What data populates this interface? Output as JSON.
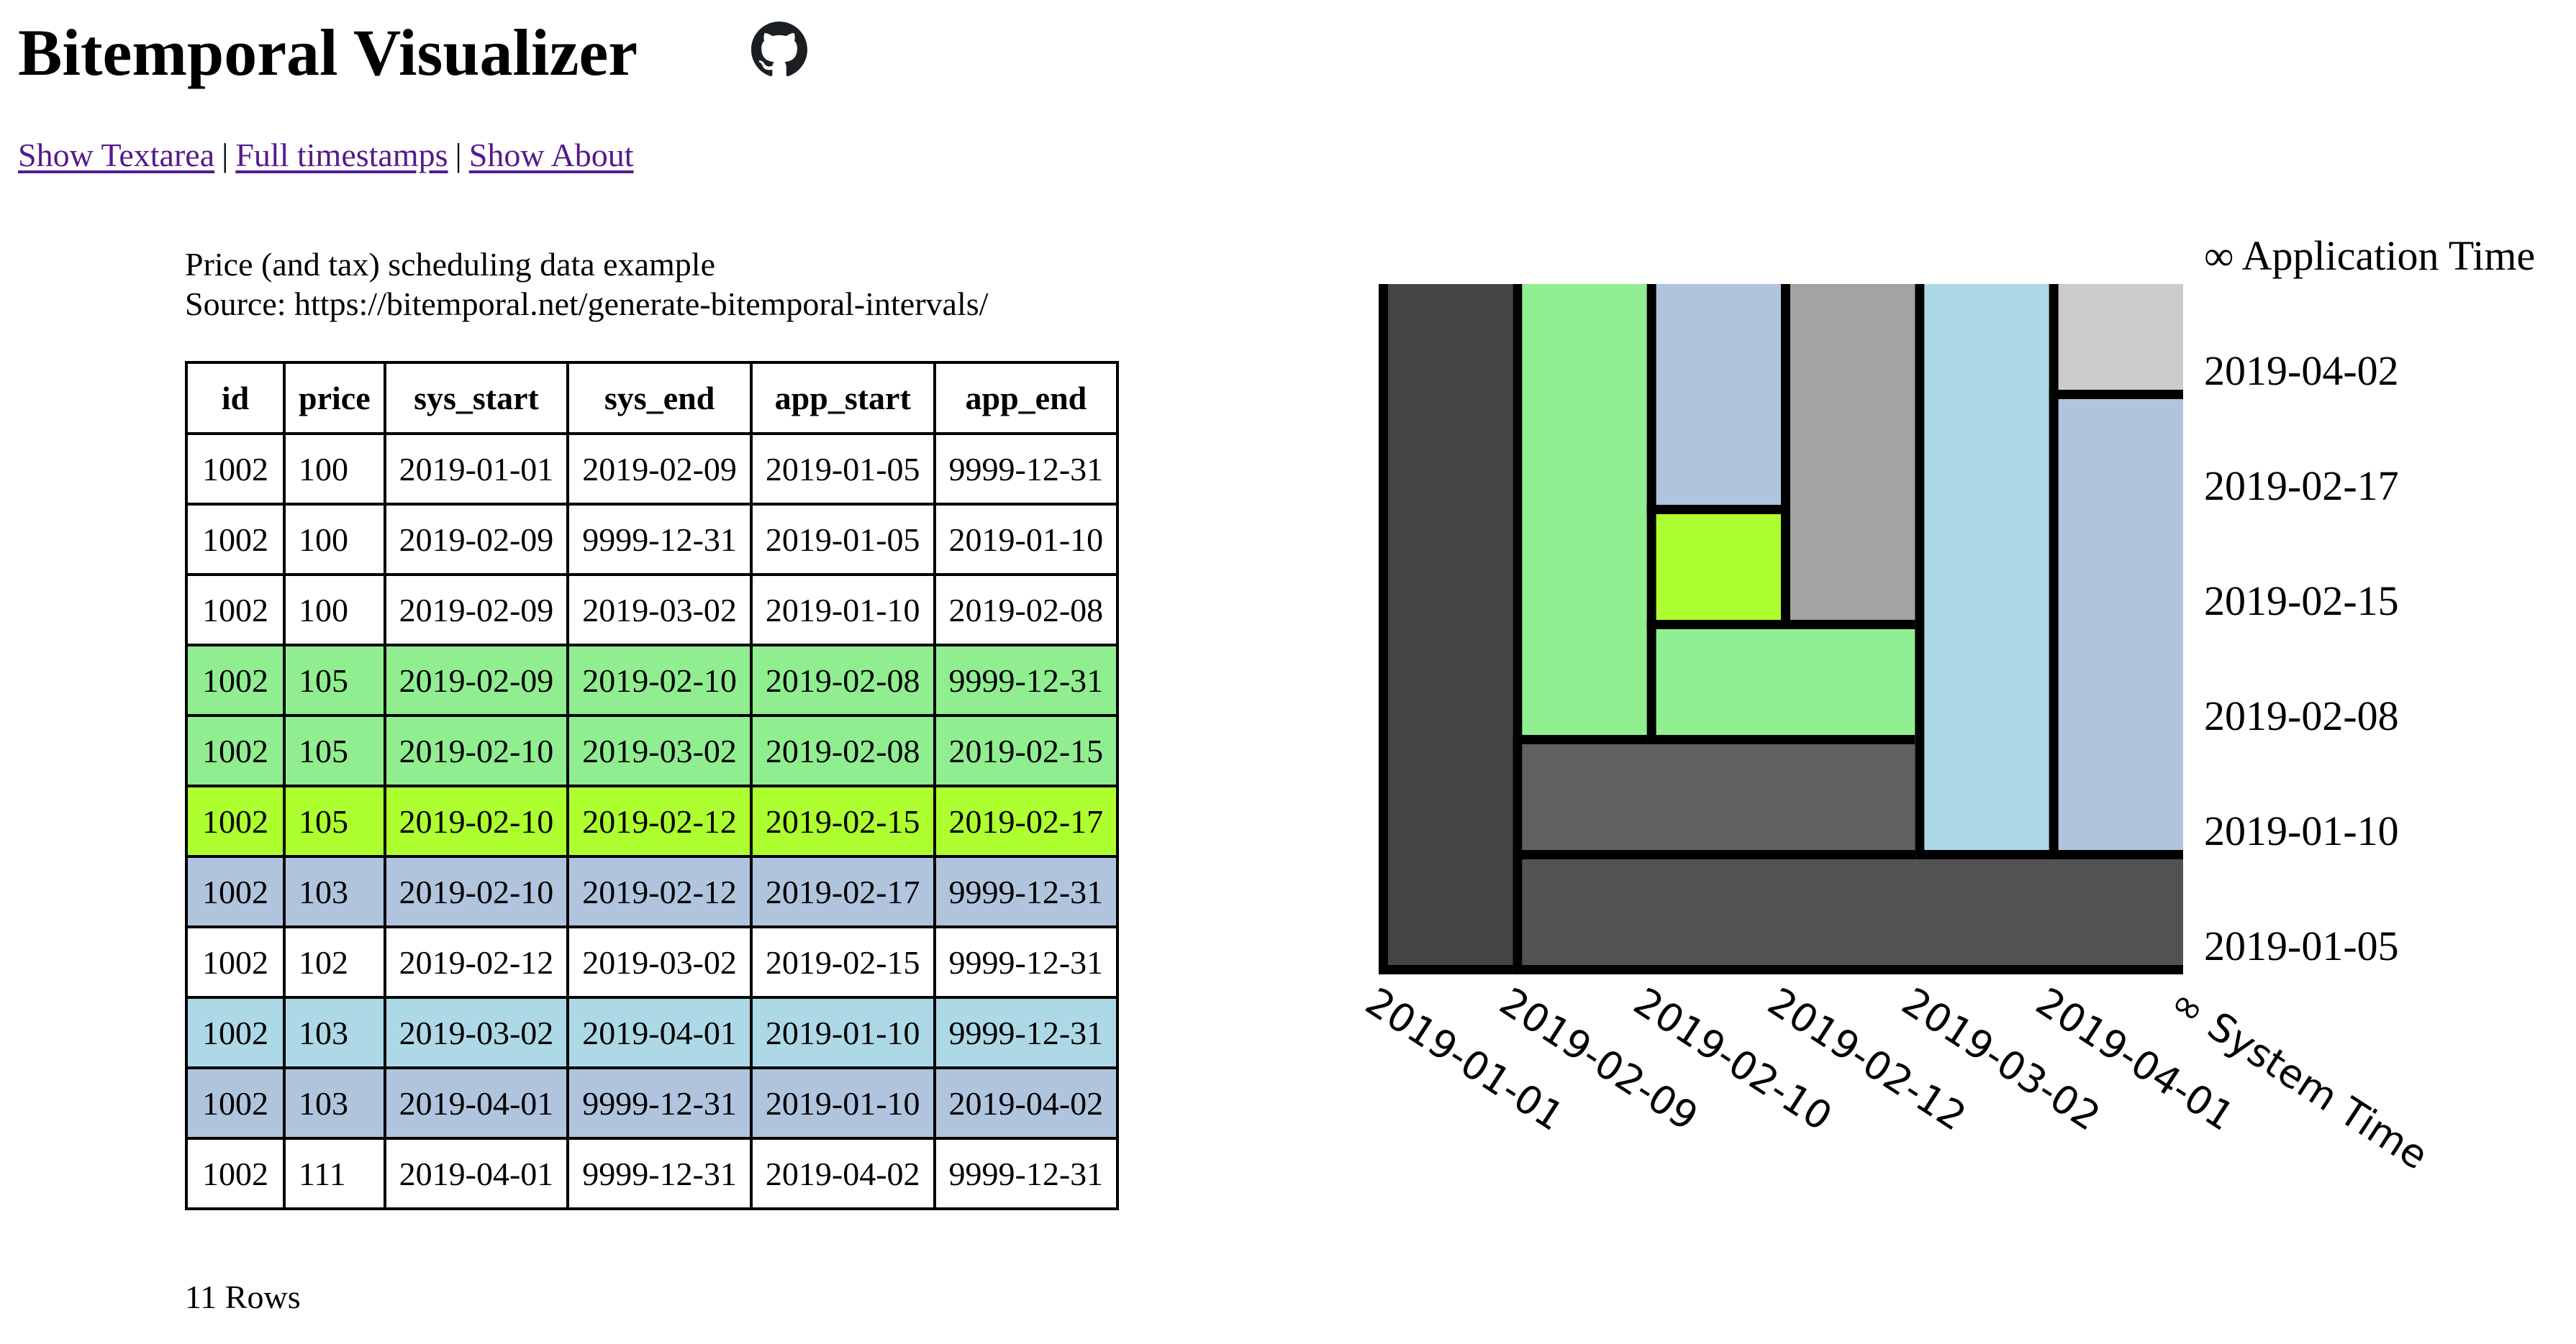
{
  "header": {
    "title": "Bitemporal Visualizer",
    "github_icon": "github-icon"
  },
  "nav": {
    "links": [
      {
        "label": "Show Textarea"
      },
      {
        "label": "Full timestamps"
      },
      {
        "label": "Show About"
      }
    ],
    "separator": "|"
  },
  "caption": {
    "line1": "Price (and tax) scheduling data example",
    "line2": "Source: https://bitemporal.net/generate-bitemporal-intervals/"
  },
  "table": {
    "columns": [
      "id",
      "price",
      "sys_start",
      "sys_end",
      "app_start",
      "app_end"
    ],
    "rows": [
      {
        "cells": [
          "1002",
          "100",
          "2019-01-01",
          "2019-02-09",
          "2019-01-05",
          "9999-12-31"
        ],
        "color": "#ffffff"
      },
      {
        "cells": [
          "1002",
          "100",
          "2019-02-09",
          "9999-12-31",
          "2019-01-05",
          "2019-01-10"
        ],
        "color": "#ffffff"
      },
      {
        "cells": [
          "1002",
          "100",
          "2019-02-09",
          "2019-03-02",
          "2019-01-10",
          "2019-02-08"
        ],
        "color": "#ffffff"
      },
      {
        "cells": [
          "1002",
          "105",
          "2019-02-09",
          "2019-02-10",
          "2019-02-08",
          "9999-12-31"
        ],
        "color": "#90ee90"
      },
      {
        "cells": [
          "1002",
          "105",
          "2019-02-10",
          "2019-03-02",
          "2019-02-08",
          "2019-02-15"
        ],
        "color": "#90ee90"
      },
      {
        "cells": [
          "1002",
          "105",
          "2019-02-10",
          "2019-02-12",
          "2019-02-15",
          "2019-02-17"
        ],
        "color": "#adff2f"
      },
      {
        "cells": [
          "1002",
          "103",
          "2019-02-10",
          "2019-02-12",
          "2019-02-17",
          "9999-12-31"
        ],
        "color": "#b0c4de"
      },
      {
        "cells": [
          "1002",
          "102",
          "2019-02-12",
          "2019-03-02",
          "2019-02-15",
          "9999-12-31"
        ],
        "color": "#ffffff"
      },
      {
        "cells": [
          "1002",
          "103",
          "2019-03-02",
          "2019-04-01",
          "2019-01-10",
          "9999-12-31"
        ],
        "color": "#add8e6"
      },
      {
        "cells": [
          "1002",
          "103",
          "2019-04-01",
          "9999-12-31",
          "2019-01-10",
          "2019-04-02"
        ],
        "color": "#b0c4de"
      },
      {
        "cells": [
          "1002",
          "111",
          "2019-04-01",
          "9999-12-31",
          "2019-04-02",
          "9999-12-31"
        ],
        "color": "#ffffff"
      }
    ],
    "row_count_label": "11 Rows"
  },
  "chart_data": {
    "type": "heatmap",
    "title": "",
    "xlabel": "∞ System Time",
    "ylabel": "∞ Application Time",
    "x_ticks": [
      "2019-01-01",
      "2019-02-09",
      "2019-02-10",
      "2019-02-12",
      "2019-03-02",
      "2019-04-01"
    ],
    "y_ticks": [
      "2019-01-05",
      "2019-01-10",
      "2019-02-08",
      "2019-02-15",
      "2019-02-17",
      "2019-04-02"
    ],
    "infinity_value": "9999-12-31",
    "scale": "ordinal",
    "rects": [
      {
        "sys_start": "2019-01-01",
        "sys_end": "2019-02-09",
        "app_start": "2019-01-05",
        "app_end": "9999-12-31",
        "price": 100,
        "color": "#444444"
      },
      {
        "sys_start": "2019-02-09",
        "sys_end": "9999-12-31",
        "app_start": "2019-01-05",
        "app_end": "2019-01-10",
        "price": 100,
        "color": "#525252"
      },
      {
        "sys_start": "2019-02-09",
        "sys_end": "2019-03-02",
        "app_start": "2019-01-10",
        "app_end": "2019-02-08",
        "price": 100,
        "color": "#616161"
      },
      {
        "sys_start": "2019-02-09",
        "sys_end": "2019-02-10",
        "app_start": "2019-02-08",
        "app_end": "9999-12-31",
        "price": 105,
        "color": "#90ee90"
      },
      {
        "sys_start": "2019-02-10",
        "sys_end": "2019-03-02",
        "app_start": "2019-02-08",
        "app_end": "2019-02-15",
        "price": 105,
        "color": "#90ee90"
      },
      {
        "sys_start": "2019-02-10",
        "sys_end": "2019-02-12",
        "app_start": "2019-02-15",
        "app_end": "2019-02-17",
        "price": 105,
        "color": "#adff2f"
      },
      {
        "sys_start": "2019-02-10",
        "sys_end": "2019-02-12",
        "app_start": "2019-02-17",
        "app_end": "9999-12-31",
        "price": 103,
        "color": "#b0c4de"
      },
      {
        "sys_start": "2019-02-12",
        "sys_end": "2019-03-02",
        "app_start": "2019-02-15",
        "app_end": "9999-12-31",
        "price": 102,
        "color": "#a3a3a3"
      },
      {
        "sys_start": "2019-03-02",
        "sys_end": "2019-04-01",
        "app_start": "2019-01-10",
        "app_end": "9999-12-31",
        "price": 103,
        "color": "#add8e6"
      },
      {
        "sys_start": "2019-04-01",
        "sys_end": "9999-12-31",
        "app_start": "2019-01-10",
        "app_end": "2019-04-02",
        "price": 103,
        "color": "#b0c4de"
      },
      {
        "sys_start": "2019-04-01",
        "sys_end": "9999-12-31",
        "app_start": "2019-04-02",
        "app_end": "9999-12-31",
        "price": 111,
        "color": "#cccccc"
      }
    ]
  }
}
